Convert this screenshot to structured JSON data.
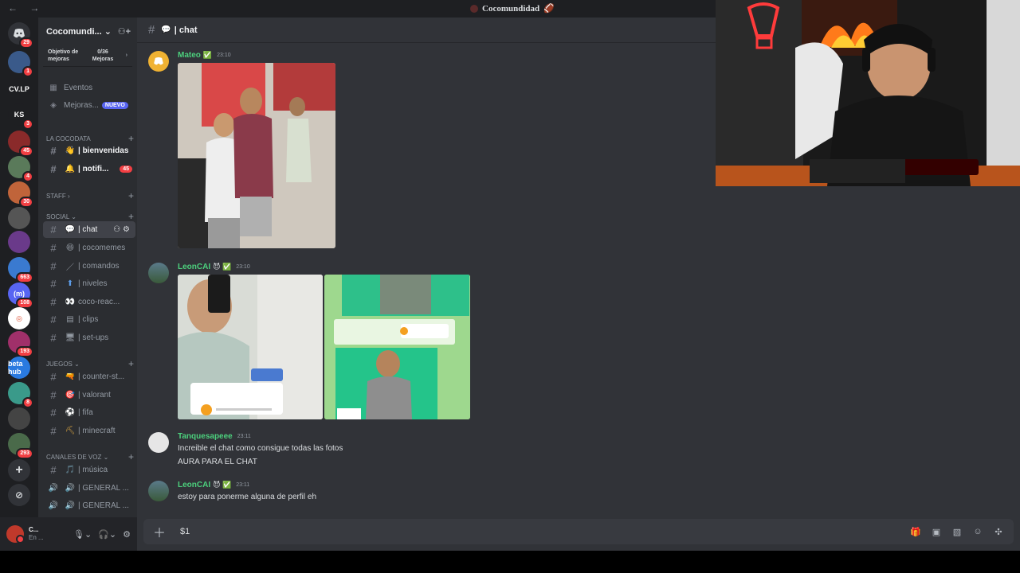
{
  "window": {
    "title": "Cocomundidad"
  },
  "server": {
    "name": "Cocomundi...",
    "boost": {
      "label": "Objetivo de mejoras",
      "progress": "0/36 Mejoras"
    }
  },
  "rail": {
    "home_badge": "29",
    "servers": [
      {
        "label": "",
        "badge": "1",
        "color": "#3a5a8a"
      },
      {
        "label": "CV.LP",
        "badge": "",
        "color": "#1e1f22"
      },
      {
        "label": "KS",
        "badge": "3",
        "color": "#1e1f22"
      },
      {
        "label": "",
        "badge": "45",
        "color": "#8a2a2a"
      },
      {
        "label": "",
        "badge": "4",
        "color": "#5a7a5a"
      },
      {
        "label": "",
        "badge": "30",
        "color": "#c0643a"
      },
      {
        "label": "",
        "badge": "",
        "color": "#555"
      },
      {
        "label": "",
        "badge": "",
        "color": "#6a3a8a"
      },
      {
        "label": "",
        "badge": "663",
        "color": "#3a7ad0"
      },
      {
        "label": "(m)",
        "badge": "108",
        "color": "#5865f2"
      },
      {
        "label": "◎",
        "badge": "",
        "color": "#ffffff"
      },
      {
        "label": "",
        "badge": "193",
        "color": "#a0306a"
      },
      {
        "label": "beta hub",
        "badge": "",
        "color": "#2a7ae0"
      },
      {
        "label": "",
        "badge": "8",
        "color": "#3a9a8a"
      },
      {
        "label": "",
        "badge": "",
        "color": "#444"
      },
      {
        "label": "",
        "badge": "293",
        "color": "#4a6a4a"
      }
    ]
  },
  "sidebar": {
    "top_items": [
      {
        "icon": "calendar-icon",
        "label": "Eventos"
      },
      {
        "icon": "boost-icon",
        "label": "Mejoras...",
        "tag": "NUEVO"
      }
    ],
    "categories": [
      {
        "name": "LA COCODATA"
      },
      {
        "name": "STAFF"
      },
      {
        "name": "SOCIAL"
      },
      {
        "name": "JUEGOS"
      },
      {
        "name": "CANALES DE VOZ"
      }
    ],
    "channels": [
      {
        "emoji": "👋",
        "label": "| bienvenidas",
        "badge": ""
      },
      {
        "emoji": "🔔",
        "label": "| notifi...",
        "badge": "45"
      },
      {
        "emoji": "💬",
        "label": "| chat"
      },
      {
        "emoji": "😆",
        "label": "| cocomemes"
      },
      {
        "emoji": "／",
        "label": "| comandos"
      },
      {
        "emoji": "⬆",
        "label": "| niveles"
      },
      {
        "emoji": "👀",
        "label": "coco-reac..."
      },
      {
        "emoji": "▤",
        "label": "| clips"
      },
      {
        "emoji": "🖥",
        "label": "| set-ups"
      },
      {
        "emoji": "🔫",
        "label": "| counter-st..."
      },
      {
        "emoji": "🎯",
        "label": "| valorant"
      },
      {
        "emoji": "⚽",
        "label": "| fifa"
      },
      {
        "emoji": "⛏",
        "label": "| minecraft"
      },
      {
        "emoji": "🎵",
        "label": "| música"
      },
      {
        "emoji": "🔊",
        "label": "| GENERAL ..."
      },
      {
        "emoji": "🔊",
        "label": "| GENERAL ..."
      }
    ]
  },
  "user": {
    "name": "C...",
    "status": "En ..."
  },
  "channel": {
    "emoji": "💬",
    "name": "| chat"
  },
  "messages": [
    {
      "author": "Mateo",
      "tag_icon": "✅",
      "time": "23:10",
      "text": []
    },
    {
      "author": "LeonCAI",
      "tag_icon": "😈 ✅",
      "time": "23:10",
      "text": []
    },
    {
      "author": "Tanquesapeee",
      "tag_icon": "",
      "time": "23:11",
      "text": [
        "Increible el chat como consigue todas las fotos",
        "AURA PARA EL CHAT"
      ]
    },
    {
      "author": "LeonCAI",
      "tag_icon": "😈 ✅",
      "time": "23:11",
      "text": [
        "estoy para ponerme alguna de perfil eh"
      ]
    }
  ],
  "composer": {
    "value": "$1",
    "placeholder": ""
  },
  "colors": {
    "accent": "#5865f2",
    "mention": "#f23f43",
    "author": "#4cd07d"
  }
}
